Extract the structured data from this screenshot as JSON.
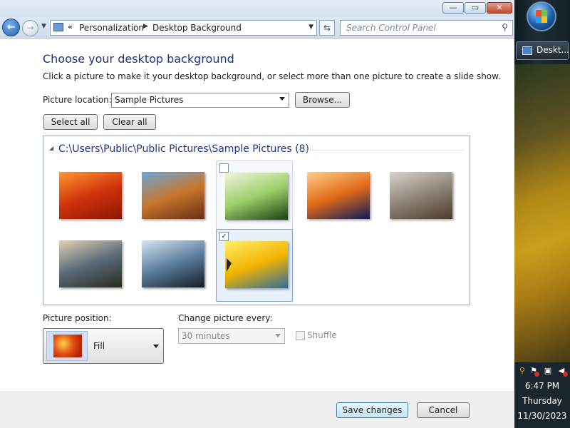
{
  "window": {
    "minimize_glyph": "—",
    "maximize_glyph": "▭",
    "close_glyph": "✕"
  },
  "nav": {
    "back_glyph": "←",
    "forward_glyph": "→",
    "history_glyph": "▼",
    "address_prefix": "«",
    "breadcrumbs": [
      "Personalization",
      "Desktop Background"
    ],
    "crumb_separator": "▶",
    "dropdown_glyph": "▼",
    "refresh_glyph": "⇆",
    "search_placeholder": "Search Control Panel",
    "search_glyph": "⚲"
  },
  "content": {
    "title": "Choose your desktop background",
    "subtitle": "Click a picture to make it your desktop background, or select more than one picture to create a slide show.",
    "picture_location_label": "Picture location:",
    "picture_location_value": "Sample Pictures",
    "browse_label": "Browse...",
    "select_all_label": "Select all",
    "clear_all_label": "Clear all"
  },
  "gallery": {
    "toggle_glyph": "◢",
    "group_title": "C:\\Users\\Public\\Public Pictures\\Sample Pictures (8)",
    "pictures": [
      {
        "subject": "chrysanthemum",
        "state": "normal",
        "checked": false,
        "colors": [
          "#ff9a2e",
          "#d0320d",
          "#8c1600"
        ]
      },
      {
        "subject": "desert",
        "state": "normal",
        "checked": false,
        "colors": [
          "#6aa6dd",
          "#c7772e",
          "#6a2d10"
        ]
      },
      {
        "subject": "hydrangeas",
        "state": "hover",
        "checked": false,
        "colors": [
          "#f2f5df",
          "#9ccf69",
          "#1a3f11"
        ]
      },
      {
        "subject": "jellyfish",
        "state": "normal",
        "checked": false,
        "colors": [
          "#ffd08a",
          "#e06a18",
          "#0b1a5a"
        ]
      },
      {
        "subject": "koala",
        "state": "normal",
        "checked": false,
        "colors": [
          "#d9d4cc",
          "#8f8478",
          "#4f3a26"
        ]
      },
      {
        "subject": "lighthouse",
        "state": "normal",
        "checked": false,
        "colors": [
          "#e2d1b4",
          "#5a6a7a",
          "#2a2a1e"
        ]
      },
      {
        "subject": "penguins",
        "state": "normal",
        "checked": false,
        "colors": [
          "#d5e4f2",
          "#5b7e9e",
          "#141a22"
        ]
      },
      {
        "subject": "tulips",
        "state": "selected",
        "checked": true,
        "colors": [
          "#fff06a",
          "#f2b400",
          "#2d6d9c"
        ]
      }
    ],
    "check_glyph": "✓"
  },
  "options": {
    "position_label": "Picture position:",
    "position_value": "Fill",
    "change_label": "Change picture every:",
    "interval_value": "30 minutes",
    "shuffle_label": "Shuffle",
    "shuffle_checked": false
  },
  "footer": {
    "save_label": "Save changes",
    "cancel_label": "Cancel"
  },
  "taskbar": {
    "task_label": "Deskt...",
    "tray_icons": [
      "search-icon",
      "action-center-flag-icon",
      "network-icon",
      "volume-icon"
    ],
    "time": "6:47 PM",
    "day": "Thursday",
    "date": "11/30/2023"
  }
}
